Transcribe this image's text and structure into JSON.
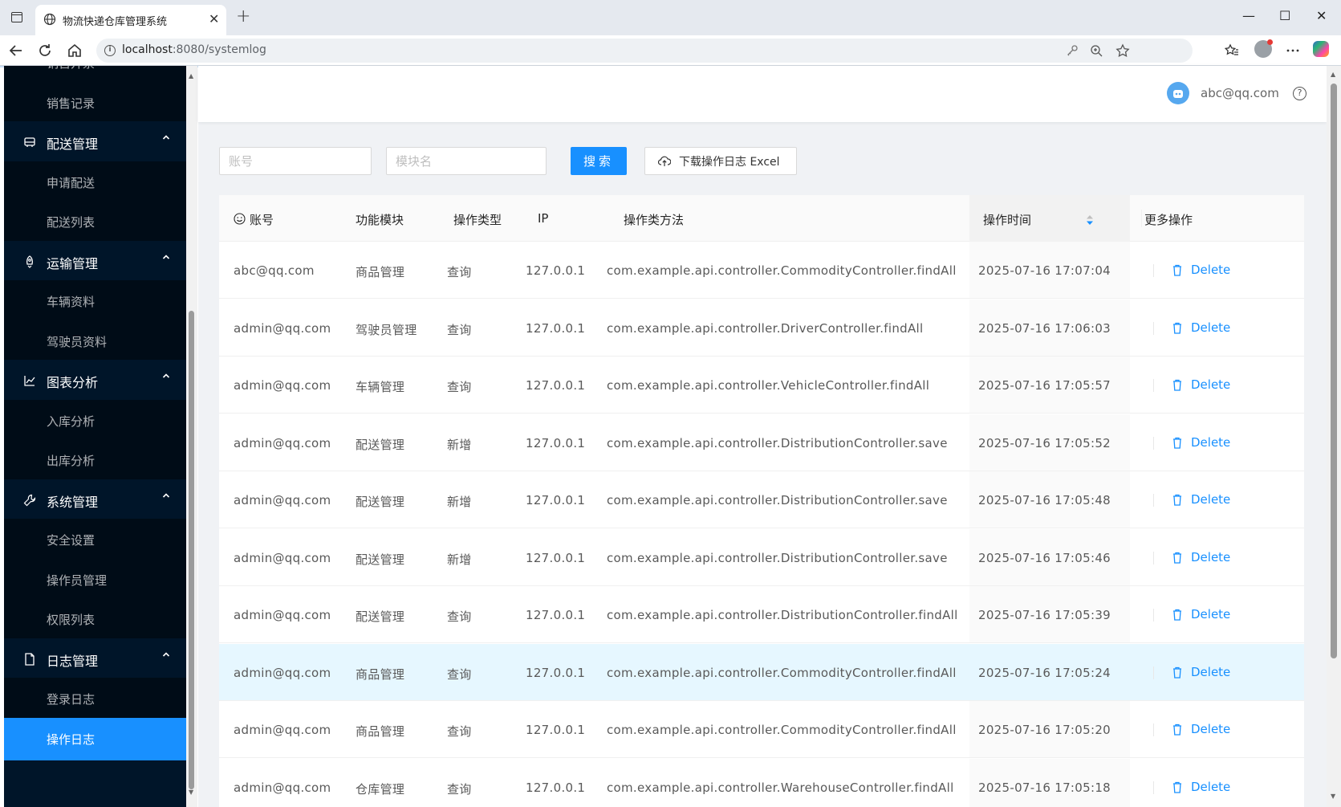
{
  "browser": {
    "tab_title": "物流快递仓库管理系统",
    "url_host": "localhost",
    "url_rest": ":8080/systemlog",
    "tab_close": "✕",
    "new_tab": "+",
    "minimize": "—",
    "maximize": "☐",
    "close": "✕"
  },
  "sidebar": {
    "items": [
      {
        "type": "sub",
        "label": "销售开票"
      },
      {
        "type": "sub",
        "label": "销售记录"
      },
      {
        "type": "group",
        "label": "配送管理",
        "icon": "truck-icon"
      },
      {
        "type": "sub",
        "label": "申请配送"
      },
      {
        "type": "sub",
        "label": "配送列表"
      },
      {
        "type": "group",
        "label": "运输管理",
        "icon": "rocket-icon"
      },
      {
        "type": "sub",
        "label": "车辆资料"
      },
      {
        "type": "sub",
        "label": "驾驶员资料"
      },
      {
        "type": "group",
        "label": "图表分析",
        "icon": "line-chart-icon"
      },
      {
        "type": "sub",
        "label": "入库分析"
      },
      {
        "type": "sub",
        "label": "出库分析"
      },
      {
        "type": "group",
        "label": "系统管理",
        "icon": "wrench-icon"
      },
      {
        "type": "sub",
        "label": "安全设置"
      },
      {
        "type": "sub",
        "label": "操作员管理"
      },
      {
        "type": "sub",
        "label": "权限列表"
      },
      {
        "type": "group",
        "label": "日志管理",
        "icon": "file-icon"
      },
      {
        "type": "sub",
        "label": "登录日志"
      },
      {
        "type": "sub",
        "label": "操作日志",
        "active": true
      }
    ]
  },
  "header": {
    "user_email": "abc@qq.com",
    "help": "?"
  },
  "search": {
    "account_placeholder": "账号",
    "module_placeholder": "模块名",
    "search_label": "搜索",
    "download_label": "下载操作日志 Excel"
  },
  "table": {
    "columns": [
      "账号",
      "功能模块",
      "操作类型",
      "IP",
      "操作类方法",
      "操作时间",
      "更多操作"
    ],
    "delete_label": "Delete",
    "rows": [
      {
        "account": "abc@qq.com",
        "module": "商品管理",
        "type": "查询",
        "ip": "127.0.0.1",
        "method": "com.example.api.controller.CommodityController.findAll",
        "time": "2025-07-16 17:07:04"
      },
      {
        "account": "admin@qq.com",
        "module": "驾驶员管理",
        "type": "查询",
        "ip": "127.0.0.1",
        "method": "com.example.api.controller.DriverController.findAll",
        "time": "2025-07-16 17:06:03"
      },
      {
        "account": "admin@qq.com",
        "module": "车辆管理",
        "type": "查询",
        "ip": "127.0.0.1",
        "method": "com.example.api.controller.VehicleController.findAll",
        "time": "2025-07-16 17:05:57"
      },
      {
        "account": "admin@qq.com",
        "module": "配送管理",
        "type": "新增",
        "ip": "127.0.0.1",
        "method": "com.example.api.controller.DistributionController.save",
        "time": "2025-07-16 17:05:52"
      },
      {
        "account": "admin@qq.com",
        "module": "配送管理",
        "type": "新增",
        "ip": "127.0.0.1",
        "method": "com.example.api.controller.DistributionController.save",
        "time": "2025-07-16 17:05:48"
      },
      {
        "account": "admin@qq.com",
        "module": "配送管理",
        "type": "新增",
        "ip": "127.0.0.1",
        "method": "com.example.api.controller.DistributionController.save",
        "time": "2025-07-16 17:05:46"
      },
      {
        "account": "admin@qq.com",
        "module": "配送管理",
        "type": "查询",
        "ip": "127.0.0.1",
        "method": "com.example.api.controller.DistributionController.findAll",
        "time": "2025-07-16 17:05:39"
      },
      {
        "account": "admin@qq.com",
        "module": "商品管理",
        "type": "查询",
        "ip": "127.0.0.1",
        "method": "com.example.api.controller.CommodityController.findAll",
        "time": "2025-07-16 17:05:24"
      },
      {
        "account": "admin@qq.com",
        "module": "商品管理",
        "type": "查询",
        "ip": "127.0.0.1",
        "method": "com.example.api.controller.CommodityController.findAll",
        "time": "2025-07-16 17:05:20"
      },
      {
        "account": "admin@qq.com",
        "module": "仓库管理",
        "type": "查询",
        "ip": "127.0.0.1",
        "method": "com.example.api.controller.WarehouseController.findAll",
        "time": "2025-07-16 17:05:18"
      }
    ]
  },
  "colors": {
    "sidebar_bg": "#001529",
    "submenu_bg": "#000c17",
    "accent": "#1890ff",
    "row_hover": "#e6f7ff"
  }
}
